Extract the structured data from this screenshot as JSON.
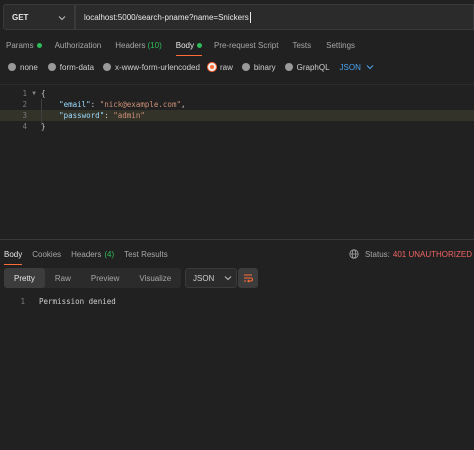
{
  "request": {
    "method": "GET",
    "url": "localhost:5000/search-pname?name=Snickers"
  },
  "request_tabs": [
    {
      "label": "Params",
      "dot": true,
      "active": false
    },
    {
      "label": "Authorization",
      "active": false
    },
    {
      "label": "Headers",
      "count": "(10)",
      "active": false
    },
    {
      "label": "Body",
      "dot": true,
      "active": true
    },
    {
      "label": "Pre-request Script",
      "active": false
    },
    {
      "label": "Tests",
      "active": false
    },
    {
      "label": "Settings",
      "active": false
    }
  ],
  "body_types": [
    {
      "label": "none",
      "selected": false
    },
    {
      "label": "form-data",
      "selected": false
    },
    {
      "label": "x-www-form-urlencoded",
      "selected": false
    },
    {
      "label": "raw",
      "selected": true
    },
    {
      "label": "binary",
      "selected": false
    },
    {
      "label": "GraphQL",
      "selected": false
    }
  ],
  "body_format": "JSON",
  "editor": {
    "lines": [
      {
        "num": "1",
        "text": "{"
      },
      {
        "num": "2",
        "key": "\"email\"",
        "sep": ": ",
        "value": "\"nick@example.com\"",
        "end": ","
      },
      {
        "num": "3",
        "key": "\"password\"",
        "sep": ": ",
        "value": "\"admin\"",
        "end": ""
      },
      {
        "num": "4",
        "text": "}"
      }
    ]
  },
  "response_tabs": [
    {
      "label": "Body",
      "active": true
    },
    {
      "label": "Cookies",
      "active": false
    },
    {
      "label": "Headers",
      "count": "(4)",
      "active": false
    },
    {
      "label": "Test Results",
      "active": false
    }
  ],
  "status": {
    "label": "Status:",
    "value": "401 UNAUTHORIZED"
  },
  "view_modes": [
    "Pretty",
    "Raw",
    "Preview",
    "Visualize"
  ],
  "response_format": "JSON",
  "response_body": {
    "line_num": "1",
    "text": "Permission denied"
  },
  "colors": {
    "accent": "#ff6c37",
    "success": "#2ebd59",
    "error": "#f26464",
    "link": "#4aa3f0"
  }
}
